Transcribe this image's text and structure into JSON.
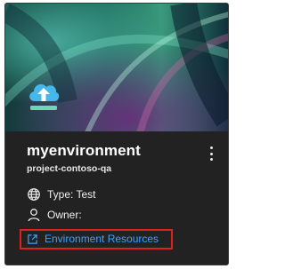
{
  "card": {
    "name": "myenvironment",
    "project": "project-contoso-qa",
    "type_label": "Type: Test",
    "owner_label": "Owner:",
    "resources_link": "Environment Resources"
  },
  "colors": {
    "card_background": "#222222",
    "link": "#3aa0ff",
    "highlight_border": "#e01f1f",
    "icon_cloud": "#45b7e8",
    "icon_base": "#6ed6b8"
  },
  "icons": {
    "menu": "more-vertical-icon",
    "environment": "cloud-upload-icon",
    "type": "globe-icon",
    "owner": "person-icon",
    "link": "open-external-icon"
  }
}
